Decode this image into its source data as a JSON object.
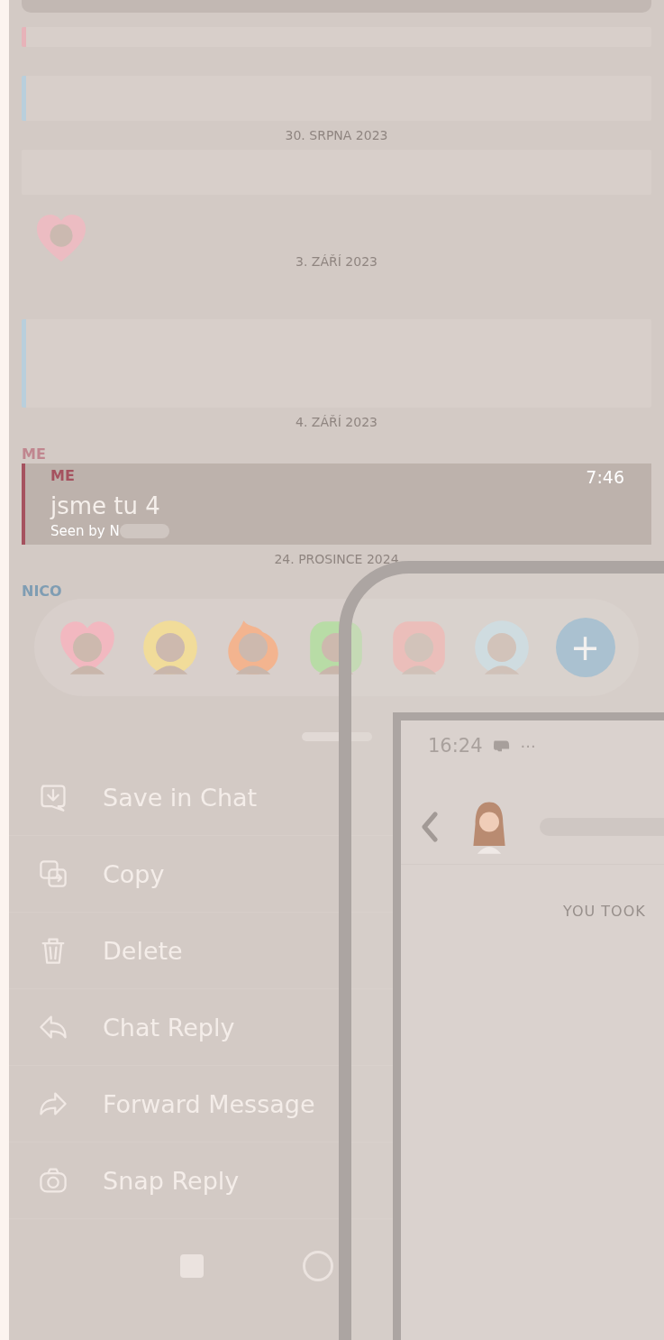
{
  "chat": {
    "items": [
      {
        "kind": "strip",
        "color": "#e7b3b9"
      },
      {
        "kind": "bubble",
        "color": "#b9cfdc"
      },
      {
        "kind": "date",
        "text": "30. SRPNA 2023"
      },
      {
        "kind": "bubble",
        "color": "#d8cfca"
      },
      {
        "kind": "sticker"
      },
      {
        "kind": "date",
        "text": "3. ZÁŘÍ 2023"
      },
      {
        "kind": "block",
        "color": "#b9cfdc"
      },
      {
        "kind": "date",
        "text": "4. ZÁŘÍ 2023"
      },
      {
        "kind": "sender",
        "text": "ME",
        "color": "#c0868f"
      },
      {
        "kind": "message",
        "sender": "ME",
        "time": "7:46",
        "text": "jsme tu 4",
        "seen": "Seen by N",
        "color": "#a5525f"
      },
      {
        "kind": "date",
        "text": "24. PROSINCE 2024"
      },
      {
        "kind": "sender",
        "text": "NICO",
        "color": "#7f9db3"
      }
    ]
  },
  "reactions": {
    "items": [
      {
        "kind": "heart",
        "color": "#f2b8c0"
      },
      {
        "kind": "circle",
        "color": "#f1dc9a"
      },
      {
        "kind": "flame",
        "color": "#f3b48f"
      },
      {
        "kind": "rounded",
        "color": "#b8dca6"
      },
      {
        "kind": "rounded",
        "color": "#f3b1ae"
      },
      {
        "kind": "circle",
        "color": "#c8dfe8"
      }
    ],
    "add": "+"
  },
  "menu": [
    {
      "kind": "save",
      "label": "Save in Chat"
    },
    {
      "kind": "copy",
      "label": "Copy"
    },
    {
      "kind": "delete",
      "label": "Delete"
    },
    {
      "kind": "reply",
      "label": "Chat Reply"
    },
    {
      "kind": "forward",
      "label": "Forward Message"
    },
    {
      "kind": "camera",
      "label": "Snap Reply"
    }
  ],
  "overlay": {
    "time": "16:24",
    "more": "···",
    "notice": "YOU TOOK"
  }
}
